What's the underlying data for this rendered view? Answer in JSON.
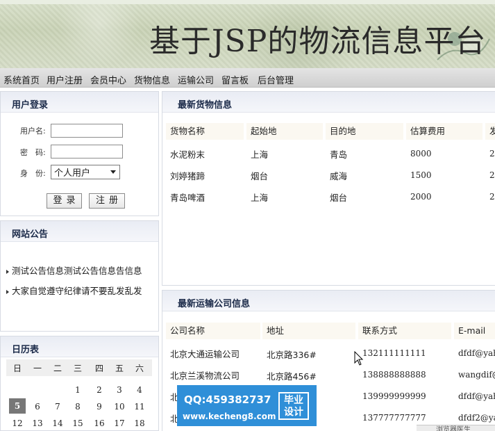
{
  "banner": {
    "title": "基于JSP的物流信息平台"
  },
  "nav": {
    "items": [
      "系统首页",
      "用户注册",
      "会员中心",
      "货物信息",
      "运输公司",
      "留言板",
      "后台管理"
    ]
  },
  "login": {
    "title": "用户登录",
    "username_label": "用户名:",
    "password_label": "密　码:",
    "role_label": "身　份:",
    "role_value": "个人用户",
    "login_button": "登录",
    "register_button": "注册"
  },
  "notices": {
    "title": "网站公告",
    "items": [
      "测试公告信息测试公告信息告信息",
      "大家自觉遵守纪律请不要乱发乱发"
    ]
  },
  "calendar": {
    "title": "日历表",
    "weekdays": [
      "日",
      "一",
      "二",
      "三",
      "四",
      "五",
      "六"
    ],
    "week1": [
      "",
      "",
      "",
      "1",
      "2",
      "3",
      "4"
    ],
    "week2": [
      "5",
      "6",
      "7",
      "8",
      "9",
      "10",
      "11"
    ],
    "week3": [
      "12",
      "13",
      "14",
      "15",
      "16",
      "17",
      "18"
    ],
    "today": "5"
  },
  "cargo": {
    "title": "最新货物信息",
    "headers": [
      "货物名称",
      "起始地",
      "目的地",
      "估算费用",
      "发"
    ],
    "rows": [
      [
        "水泥粉末",
        "上海",
        "青岛",
        "8000",
        "2"
      ],
      [
        "刘婷猪蹄",
        "烟台",
        "威海",
        "1500",
        "2"
      ],
      [
        "青岛啤酒",
        "上海",
        "烟台",
        "2000",
        "2"
      ]
    ]
  },
  "companies": {
    "title": "最新运输公司信息",
    "headers": [
      "公司名称",
      "地址",
      "联系方式",
      "E-mail"
    ],
    "rows": [
      [
        "北京大通运输公司",
        "北京路336#",
        "132111111111",
        "dfdf@yaho"
      ],
      [
        "北京兰溪物流公司",
        "北京路456#",
        "138888888888",
        "wangdif@y"
      ],
      [
        "北",
        "",
        "139999999999",
        "dfdf@yaho"
      ],
      [
        "北",
        "",
        "137777777777",
        "dfdf2@yah"
      ]
    ]
  },
  "watermark": {
    "qq": "QQ:459382737",
    "site": "www.kecheng8.com",
    "badge_line1": "毕业",
    "badge_line2": "设计"
  },
  "status_bar": {
    "text": "浏览器医生"
  }
}
